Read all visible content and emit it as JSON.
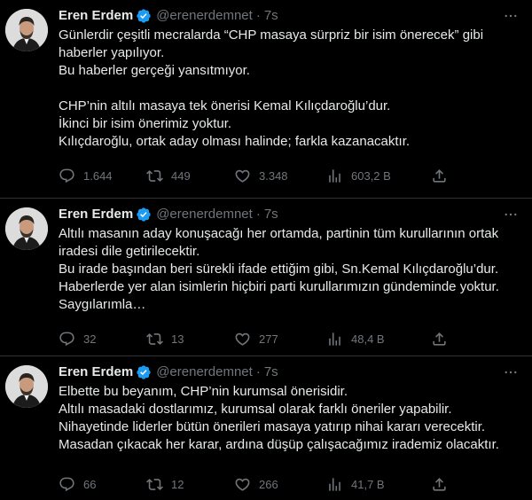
{
  "tweets": [
    {
      "name": "Eren Erdem",
      "handle": "@erenerdemnet",
      "separator": "·",
      "time": "7s",
      "lines": [
        "Günlerdir çeşitli mecralarda “CHP masaya sürpriz bir isim önerecek” gibi haberler yapılıyor.",
        "Bu haberler gerçeği yansıtmıyor.",
        "",
        "CHP’nin altılı masaya tek önerisi Kemal Kılıçdaroğlu’dur.",
        "İkinci bir isim önerimiz yoktur.",
        "Kılıçdaroğlu, ortak aday olması halinde; farkla kazanacaktır."
      ],
      "replies": "1.644",
      "retweets": "449",
      "likes": "3.348",
      "views": "603,2 B"
    },
    {
      "name": "Eren Erdem",
      "handle": "@erenerdemnet",
      "separator": "·",
      "time": "7s",
      "lines": [
        "Altılı masanın aday konuşacağı her ortamda, partinin tüm kurullarının ortak iradesi dile getirilecektir.",
        "Bu irade başından beri sürekli ifade ettiğim gibi, Sn.Kemal Kılıçdaroğlu’dur.",
        "Haberlerde yer alan isimlerin hiçbiri parti kurullarımızın gündeminde yoktur.",
        "Saygılarımla…"
      ],
      "replies": "32",
      "retweets": "13",
      "likes": "277",
      "views": "48,4 B"
    },
    {
      "name": "Eren Erdem",
      "handle": "@erenerdemnet",
      "separator": "·",
      "time": "7s",
      "lines": [
        "Elbette bu beyanım, CHP’nin kurumsal önerisidir.",
        "Altılı masadaki dostlarımız, kurumsal olarak farklı öneriler yapabilir.",
        "Nihayetinde liderler bütün önerileri masaya yatırıp nihai kararı verecektir.",
        "Masadan çıkacak her karar, ardına düşüp çalışacağımız irademiz olacaktır."
      ],
      "replies": "66",
      "retweets": "12",
      "likes": "266",
      "views": "41,7 B"
    }
  ],
  "colors": {
    "background": "#000000",
    "text": "#e7e9ea",
    "secondary": "#71767b",
    "verified": "#1d9bf0",
    "divider": "#2f3336"
  },
  "icons": [
    "more-icon",
    "verified-badge-icon",
    "reply-icon",
    "retweet-icon",
    "like-icon",
    "views-icon",
    "share-icon"
  ]
}
